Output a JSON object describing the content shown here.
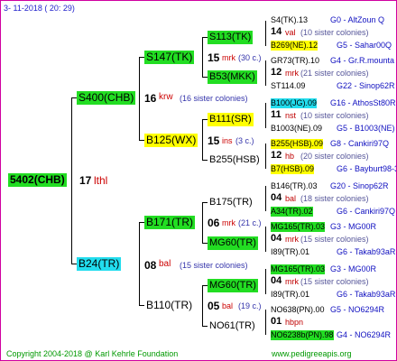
{
  "header": {
    "date": "3- 11-2018 ( 20: 29)"
  },
  "root": {
    "name": "5402(CHB)",
    "num": "17",
    "info": "lthl"
  },
  "gen1": {
    "top": {
      "name": "S400(CHB)",
      "num": "16",
      "code": "krw",
      "info": "(16 sister colonies)"
    },
    "bottom": {
      "name": "B24(TR)",
      "num": "08",
      "code": "bal",
      "info": "(15 sister colonies)"
    }
  },
  "gen2": [
    {
      "name": "S147(TK)",
      "num": "15",
      "code": "mrk",
      "info": "(30 c.)"
    },
    {
      "name": "B125(WX)",
      "num": "15",
      "code": "ins",
      "info": "(3 c.)"
    },
    {
      "name": "B171(TR)",
      "num": "06",
      "code": "mrk",
      "info": "(21 c.)"
    },
    {
      "name": "B110(TR)",
      "num": "05",
      "code": "bal",
      "info": "(19 c.)"
    }
  ],
  "gen3": [
    {
      "name": "S113(TK)",
      "hl": "g"
    },
    {
      "name": "B53(MKK)",
      "hl": "g"
    },
    {
      "name": "B111(SR)",
      "hl": "y"
    },
    {
      "name": "B255(HSB)",
      "hl": ""
    },
    {
      "name": "B175(TR)",
      "hl": ""
    },
    {
      "name": "MG60(TR)",
      "hl": "g"
    },
    {
      "name": "MG60(TR)",
      "hl": "g"
    },
    {
      "name": "NO61(TR)",
      "hl": ""
    }
  ],
  "gen4": [
    {
      "top": "S4(TK).13",
      "topr": "G0 - AltZoun Q",
      "num": "14",
      "code": "val",
      "mid": "(10 sister colonies)",
      "bot": "B269(NE).12",
      "botr": "G5 - Sahar00Q",
      "botHl": "y"
    },
    {
      "top": "GR73(TR).10",
      "topr": "G4 - Gr.R.mounta",
      "num": "12",
      "code": "mrk",
      "mid": "(21 sister colonies)",
      "bot": "ST114.09",
      "botr": "G22 - Sinop62R",
      "botHl": ""
    },
    {
      "top": "B100(JG).09",
      "topr": "G16 - AthosSt80R",
      "topHl": "c",
      "num": "11",
      "code": "nst",
      "mid": "(10 sister colonies)",
      "bot": "B1003(NE).09",
      "botr": "G5 - B1003(NE)",
      "botHl": ""
    },
    {
      "top": "B255(HSB).09",
      "topr": "G8 - Cankiri97Q",
      "topHl": "y",
      "num": "12",
      "code": "hb",
      "mid": "(20 sister colonies)",
      "bot": "B7(HSB).09",
      "botr": "G6 - Bayburt98-3",
      "botHl": "y"
    },
    {
      "top": "B146(TR).03",
      "topr": "G20 - Sinop62R",
      "num": "04",
      "code": "bal",
      "mid": "(18 sister colonies)",
      "bot": "A34(TR).02",
      "botr": "G6 - Cankiri97Q",
      "botHl": "g"
    },
    {
      "top": "MG165(TR).03",
      "topr": "G3 - MG00R",
      "topHl": "g",
      "num": "04",
      "code": "mrk",
      "mid": "(15 sister colonies)",
      "bot": "I89(TR).01",
      "botr": "G6 - Takab93aR",
      "botHl": ""
    },
    {
      "top": "MG165(TR).03",
      "topr": "G3 - MG00R",
      "topHl": "g",
      "num": "04",
      "code": "mrk",
      "mid": "(15 sister colonies)",
      "bot": "I89(TR).01",
      "botr": "G6 - Takab93aR",
      "botHl": ""
    },
    {
      "top": "NO638(PN).00",
      "topr": "G5 - NO6294R",
      "num": "01",
      "code": "hbpn",
      "mid": "",
      "bot": "NO6238b(PN).98",
      "botr": "G4 - NO6294R",
      "botHl": "g"
    }
  ],
  "footer": {
    "copyright": "Copyright 2004-2018 @ Karl Kehrle Foundation",
    "url": "www.pedigreeapis.org"
  }
}
